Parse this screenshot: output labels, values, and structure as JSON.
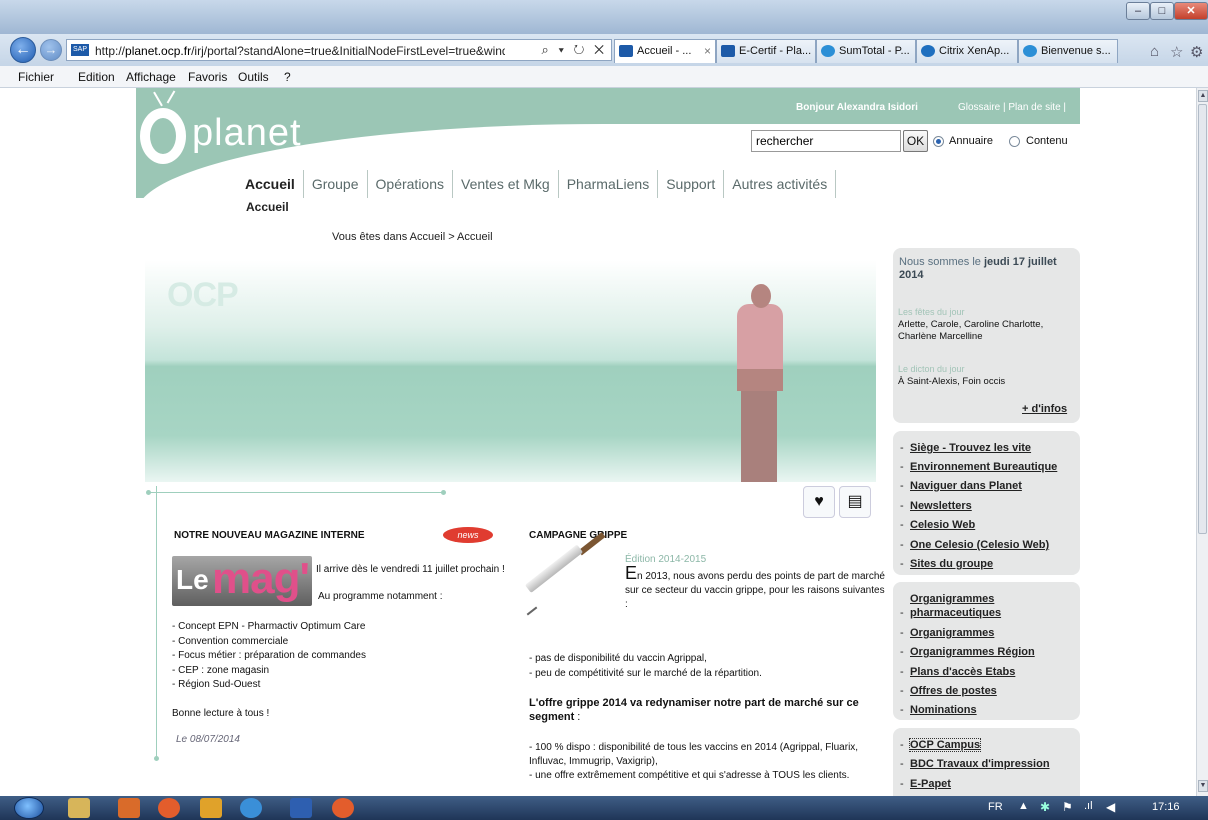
{
  "browser": {
    "url_prefix": "http://",
    "url_domain": "planet.ocp.fr",
    "url_rest": "/irj/portal?standAlone=true&InitialNodeFirstLevel=true&windowId=\\",
    "address_buttons": "⌕ ▾ ↻ ✕",
    "tabs": [
      {
        "label": "Accueil - ...",
        "close": "×",
        "active": true,
        "color": "#1d5aa8"
      },
      {
        "label": "E-Certif - Pla...",
        "active": false,
        "color": "#1d5aa8"
      },
      {
        "label": "SumTotal - P...",
        "active": false,
        "color": "#2c8fd6"
      },
      {
        "label": "Citrix XenAp...",
        "active": false,
        "color": "#1f6fbf"
      },
      {
        "label": "Bienvenue s...",
        "active": false,
        "color": "#2c8fd6"
      }
    ],
    "menu": [
      "Fichier",
      "Edition",
      "Affichage",
      "Favoris",
      "Outils",
      "?"
    ],
    "toolbar_icons": [
      "home-icon",
      "star-icon",
      "gear-icon"
    ]
  },
  "header": {
    "logo_main": "planet",
    "logo_sub": "ocp",
    "greeting": "Bonjour Alexandra Isidori",
    "links": "Glossaire | Plan de site |",
    "search_value": "rechercher",
    "ok_label": "OK",
    "radio_annuaire": "Annuaire",
    "radio_contenu": "Contenu"
  },
  "nav": {
    "items": [
      "Accueil",
      "Groupe",
      "Opérations",
      "Ventes et Mkg",
      "PharmaLiens",
      "Support",
      "Autres activités"
    ],
    "sub_item": "Accueil",
    "breadcrumb": "Vous êtes dans Accueil > Accueil"
  },
  "banner": {
    "brand": "OCP"
  },
  "magazine": {
    "title": "NOTRE NOUVEAU MAGAZINE INTERNE",
    "badge": "news",
    "logo_le": "Le",
    "logo_mag": "mag'",
    "intro": "Il arrive dès le vendredi 11 juillet prochain !",
    "programme": "Au programme notamment :",
    "items": [
      "- Concept EPN - Pharmactiv Optimum Care",
      "- Convention commerciale",
      "- Focus métier : préparation de commandes",
      "- CEP : zone magasin",
      "- Région Sud-Ouest"
    ],
    "closing": "Bonne lecture à tous !",
    "date": "Le 08/07/2014"
  },
  "grippe": {
    "title": "CAMPAGNE GRIPPE",
    "edition": "Édition 2014-2015",
    "dropcap": "E",
    "body": "n 2013, nous avons perdu des points de part de marché sur ce secteur du vaccin grippe, pour les raisons suivantes :",
    "reasons": [
      "- pas de disponibilité du vaccin Agrippal,",
      "- peu de compétitivité sur le marché de la répartition."
    ],
    "bold": "L'offre grippe 2014 va redynamiser notre part de marché sur ce segment",
    "bold_suffix": " :",
    "points": [
      "- 100 % dispo : disponibilité de tous les vaccins en 2014 (Agrippal, Fluarix, Influvac, Immugrip, Vaxigrip),",
      "- une offre extrêmement compétitive et qui s'adresse à TOUS les clients."
    ]
  },
  "sidebar": {
    "today_prefix": "Nous sommes le ",
    "today_date": "jeudi 17 juillet 2014",
    "fetes_label": "Les fêtes du jour",
    "fetes_value": "Arlette, Carole, Caroline Charlotte, Charlène Marcelline",
    "dicton_label": "Le dicton du jour",
    "dicton_value": "À Saint-Alexis, Foin occis",
    "more": "+ d'infos",
    "group1": [
      "Siège - Trouvez les vite",
      "Environnement Bureautique",
      "Naviguer dans Planet",
      "Newsletters",
      "Celesio Web",
      "One Celesio (Celesio Web)",
      "Sites du groupe"
    ],
    "group2_first_a": "Organigrammes",
    "group2_first_b": "pharmaceutiques",
    "group2": [
      "Organigrammes",
      "Organigrammes Région",
      "Plans d'accès Etabs",
      "Offres de postes",
      "Nominations"
    ],
    "group3": [
      "OCP Campus",
      "BDC Travaux d'impression",
      "E-Papet"
    ]
  },
  "taskbar": {
    "lang": "FR",
    "clock": "17:16"
  }
}
